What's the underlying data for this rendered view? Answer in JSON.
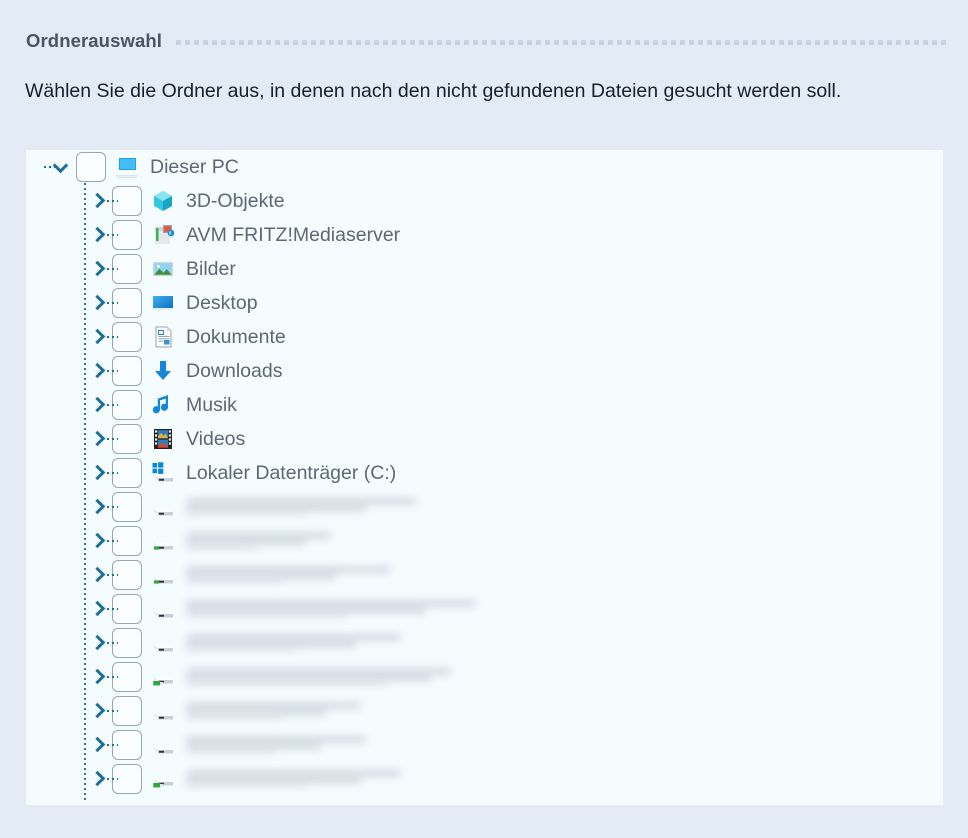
{
  "header": {
    "title": "Ordnerauswahl"
  },
  "intro": {
    "text": "Wählen Sie die Ordner aus, in denen nach den nicht gefundenen Dateien gesucht werden soll."
  },
  "colors": {
    "page_background": "#e3ebf7",
    "panel_background": "#f4fcfe",
    "header_text": "#4a5462",
    "body_text": "#16202c",
    "tree_text": "#5c6874",
    "expander": "#1d6f95",
    "checkbox_border": "#9aa5b1",
    "rule_dots": "#c8d4e6"
  },
  "tree": {
    "root": {
      "label": "Dieser PC",
      "icon": "this-pc-icon",
      "expanded": true,
      "checked": false,
      "expander_icon": "chevron-down-icon"
    },
    "items": [
      {
        "label": "3D-Objekte",
        "icon": "3d-objects-icon",
        "checked": false,
        "expander_icon": "chevron-right-icon",
        "redacted": false
      },
      {
        "label": "AVM FRITZ!Mediaserver",
        "icon": "media-server-icon",
        "checked": false,
        "expander_icon": "chevron-right-icon",
        "redacted": false
      },
      {
        "label": "Bilder",
        "icon": "pictures-icon",
        "checked": false,
        "expander_icon": "chevron-right-icon",
        "redacted": false
      },
      {
        "label": "Desktop",
        "icon": "desktop-icon",
        "checked": false,
        "expander_icon": "chevron-right-icon",
        "redacted": false
      },
      {
        "label": "Dokumente",
        "icon": "documents-icon",
        "checked": false,
        "expander_icon": "chevron-right-icon",
        "redacted": false
      },
      {
        "label": "Downloads",
        "icon": "downloads-icon",
        "checked": false,
        "expander_icon": "chevron-right-icon",
        "redacted": false
      },
      {
        "label": "Musik",
        "icon": "music-icon",
        "checked": false,
        "expander_icon": "chevron-right-icon",
        "redacted": false
      },
      {
        "label": "Videos",
        "icon": "videos-icon",
        "checked": false,
        "expander_icon": "chevron-right-icon",
        "redacted": false
      },
      {
        "label": "Lokaler Datenträger (C:)",
        "icon": "system-drive-icon",
        "checked": false,
        "expander_icon": "chevron-right-icon",
        "redacted": false
      },
      {
        "label": "",
        "icon": "drive-icon",
        "checked": false,
        "expander_icon": "chevron-right-icon",
        "redacted": true,
        "blur_widths": [
          230,
          180,
          120
        ]
      },
      {
        "label": "",
        "icon": "drive-green-icon",
        "checked": false,
        "expander_icon": "chevron-right-icon",
        "redacted": true,
        "blur_widths": [
          145,
          120,
          70
        ]
      },
      {
        "label": "",
        "icon": "drive-green-icon",
        "checked": false,
        "expander_icon": "chevron-right-icon",
        "redacted": true,
        "blur_widths": [
          205,
          150,
          95
        ]
      },
      {
        "label": "",
        "icon": "drive-icon",
        "checked": false,
        "expander_icon": "chevron-right-icon",
        "redacted": true,
        "blur_widths": [
          290,
          240,
          160
        ]
      },
      {
        "label": "",
        "icon": "drive-icon",
        "checked": false,
        "expander_icon": "chevron-right-icon",
        "redacted": true,
        "blur_widths": [
          215,
          170,
          110
        ]
      },
      {
        "label": "",
        "icon": "drive-green-usb-icon",
        "checked": false,
        "expander_icon": "chevron-right-icon",
        "redacted": true,
        "blur_widths": [
          265,
          245,
          200
        ]
      },
      {
        "label": "",
        "icon": "drive-icon",
        "checked": false,
        "expander_icon": "chevron-right-icon",
        "redacted": true,
        "blur_widths": [
          175,
          140,
          95
        ]
      },
      {
        "label": "",
        "icon": "drive-icon",
        "checked": false,
        "expander_icon": "chevron-right-icon",
        "redacted": true,
        "blur_widths": [
          180,
          135,
          90
        ]
      },
      {
        "label": "",
        "icon": "drive-green-usb-icon",
        "checked": false,
        "expander_icon": "chevron-right-icon",
        "redacted": true,
        "blur_widths": [
          215,
          175,
          120
        ]
      }
    ]
  }
}
